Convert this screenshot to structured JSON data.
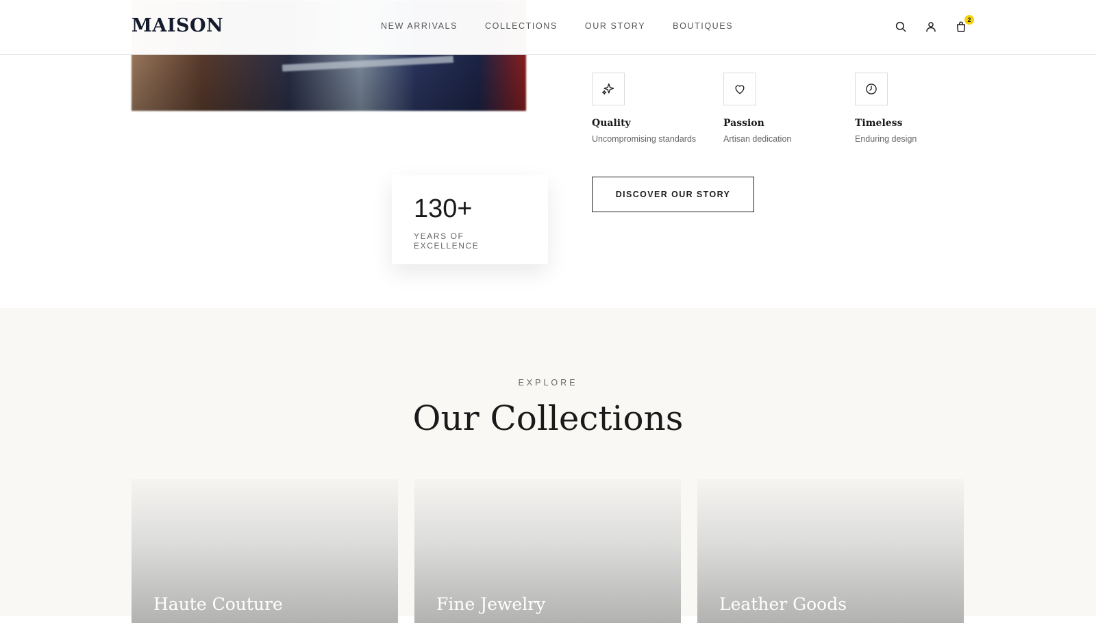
{
  "header": {
    "logo": "MAISON",
    "nav": [
      "NEW ARRIVALS",
      "COLLECTIONS",
      "OUR STORY",
      "BOUTIQUES"
    ],
    "icons": [
      "search-icon",
      "user-icon",
      "shopping-bag-icon"
    ],
    "cart_count": "2",
    "badge_color": "#f5d20a"
  },
  "story": {
    "values": [
      {
        "title": "Quality",
        "subtitle": "Uncompromising standards",
        "icon": "sparkle-icon"
      },
      {
        "title": "Passion",
        "subtitle": "Artisan dedication",
        "icon": "heart-icon"
      },
      {
        "title": "Timeless",
        "subtitle": "Enduring design",
        "icon": "clock-icon"
      }
    ],
    "cta": "DISCOVER OUR STORY",
    "stat": {
      "number": "130+",
      "label": "YEARS OF EXCELLENCE"
    }
  },
  "collections": {
    "eyebrow": "EXPLORE",
    "title": "Our Collections",
    "cards": [
      {
        "title": "Haute Couture"
      },
      {
        "title": "Fine Jewelry"
      },
      {
        "title": "Leather Goods"
      }
    ]
  }
}
